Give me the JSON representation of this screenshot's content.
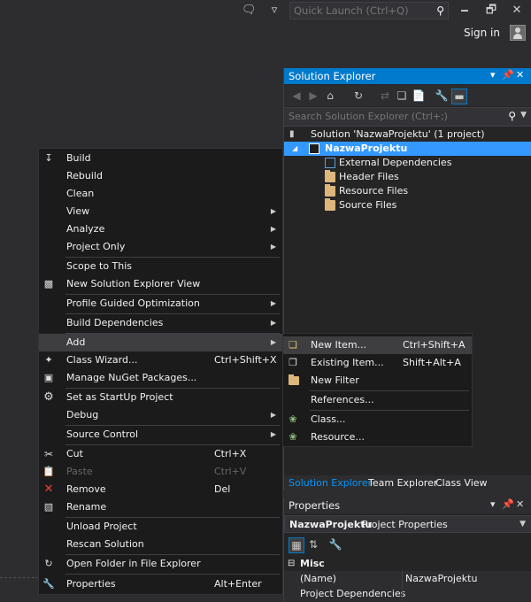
{
  "titlebar": {
    "quick_launch_placeholder": "Quick Launch (Ctrl+Q)",
    "sign_in": "Sign in",
    "minimize_glyph": "🗕",
    "restore_glyph": "🗗",
    "close_glyph": "✕"
  },
  "solution_explorer": {
    "title": "Solution Explorer",
    "search_placeholder": "Search Solution Explorer (Ctrl+;)",
    "tree": {
      "solution": "Solution 'NazwaProjektu' (1 project)",
      "project": "NazwaProjektu",
      "folders": [
        "External Dependencies",
        "Header Files",
        "Resource Files",
        "Source Files"
      ]
    },
    "tabs": [
      "Solution Explorer",
      "Team Explorer",
      "Class View"
    ]
  },
  "properties": {
    "title": "Properties",
    "selected_name": "NazwaProjektu",
    "selected_kind": "Project Properties",
    "category": "Misc",
    "rows": [
      {
        "name": "(Name)",
        "value": "NazwaProjektu"
      },
      {
        "name": "Project Dependencies",
        "value": ""
      }
    ]
  },
  "context_menu": {
    "items": [
      {
        "label": "Build",
        "shortcut": "",
        "icon": "build-icon"
      },
      {
        "label": "Rebuild",
        "shortcut": ""
      },
      {
        "label": "Clean",
        "shortcut": ""
      },
      {
        "label": "View",
        "shortcut": "",
        "submenu": true
      },
      {
        "label": "Analyze",
        "shortcut": "",
        "submenu": true
      },
      {
        "label": "Project Only",
        "shortcut": "",
        "submenu": true
      },
      {
        "label": "Scope to This",
        "shortcut": ""
      },
      {
        "label": "New Solution Explorer View",
        "shortcut": "",
        "icon": "new-view-icon"
      },
      {
        "label": "Profile Guided Optimization",
        "shortcut": "",
        "submenu": true
      },
      {
        "label": "Build Dependencies",
        "shortcut": "",
        "submenu": true
      },
      {
        "label": "Add",
        "shortcut": "",
        "submenu": true
      },
      {
        "label": "Class Wizard...",
        "shortcut": "Ctrl+Shift+X",
        "icon": "class-wizard-icon"
      },
      {
        "label": "Manage NuGet Packages...",
        "shortcut": "",
        "icon": "nuget-icon"
      },
      {
        "label": "Set as StartUp Project",
        "shortcut": "",
        "icon": "gear-icon"
      },
      {
        "label": "Debug",
        "shortcut": "",
        "submenu": true
      },
      {
        "label": "Source Control",
        "shortcut": "",
        "submenu": true
      },
      {
        "label": "Cut",
        "shortcut": "Ctrl+X",
        "icon": "scissors-icon"
      },
      {
        "label": "Paste",
        "shortcut": "Ctrl+V",
        "icon": "paste-icon",
        "disabled": true
      },
      {
        "label": "Remove",
        "shortcut": "Del",
        "icon": "remove-icon"
      },
      {
        "label": "Rename",
        "shortcut": "",
        "icon": "rename-icon"
      },
      {
        "label": "Unload Project",
        "shortcut": ""
      },
      {
        "label": "Rescan Solution",
        "shortcut": ""
      },
      {
        "label": "Open Folder in File Explorer",
        "shortcut": "",
        "icon": "open-folder-icon"
      },
      {
        "label": "Properties",
        "shortcut": "Alt+Enter",
        "icon": "wrench-icon"
      }
    ]
  },
  "add_submenu": {
    "items": [
      {
        "label": "New Item...",
        "shortcut": "Ctrl+Shift+A"
      },
      {
        "label": "Existing Item...",
        "shortcut": "Shift+Alt+A"
      },
      {
        "label": "New Filter",
        "shortcut": ""
      },
      {
        "label": "References...",
        "shortcut": ""
      },
      {
        "label": "Class...",
        "shortcut": ""
      },
      {
        "label": "Resource...",
        "shortcut": ""
      }
    ]
  },
  "colors": {
    "accent": "#007acc",
    "background": "#2d2d30",
    "menu_bg": "#1b1b1c",
    "highlight": "#3e3e40"
  }
}
